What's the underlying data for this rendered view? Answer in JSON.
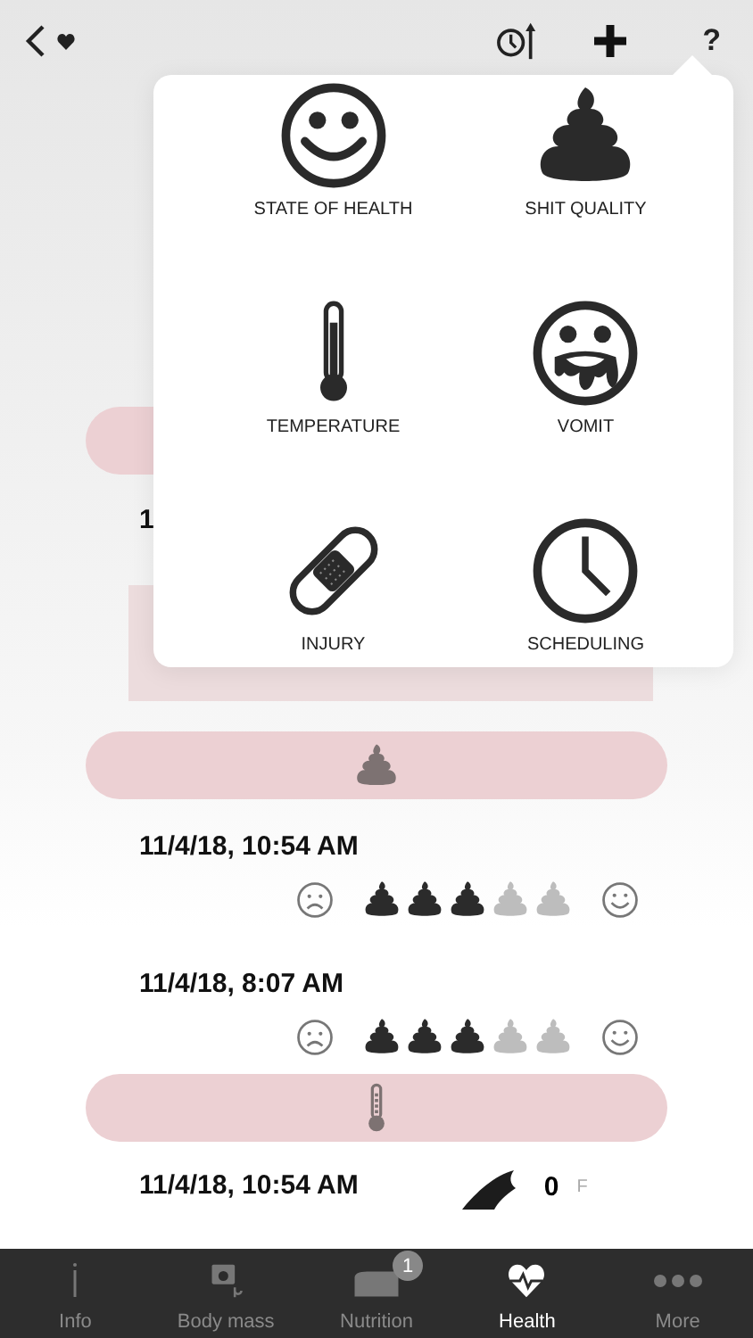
{
  "header": {
    "help": "?"
  },
  "menu": {
    "items": [
      {
        "kind": "smiley",
        "label": "STATE OF HEALTH"
      },
      {
        "kind": "poop",
        "label": "SHIT QUALITY"
      },
      {
        "kind": "thermometer",
        "label": "TEMPERATURE"
      },
      {
        "kind": "vomit",
        "label": "VOMIT"
      },
      {
        "kind": "bandage",
        "label": "INJURY"
      },
      {
        "kind": "clock",
        "label": "SCHEDULING"
      }
    ]
  },
  "sections": [
    {
      "kind": "hidden",
      "entries": [
        {
          "kind": "partial",
          "date": "1"
        }
      ]
    },
    {
      "kind": "poop",
      "entries": [
        {
          "kind": "rating",
          "date": "11/4/18, 10:54 AM",
          "stars": 3
        },
        {
          "kind": "rating",
          "date": "11/4/18, 8:07 AM",
          "stars": 3
        }
      ]
    },
    {
      "kind": "thermometer",
      "entries": [
        {
          "kind": "temperature",
          "date": "11/4/18, 10:54 AM",
          "value": "0",
          "unit": "F"
        }
      ]
    }
  ],
  "tabs": [
    {
      "kind": "info",
      "label": "Info",
      "selected": false
    },
    {
      "kind": "scale",
      "label": "Body mass",
      "selected": false
    },
    {
      "kind": "bowl",
      "label": "Nutrition",
      "selected": false,
      "badge": "1"
    },
    {
      "kind": "heart",
      "label": "Health",
      "selected": true
    },
    {
      "kind": "more",
      "label": "More",
      "selected": false
    }
  ]
}
